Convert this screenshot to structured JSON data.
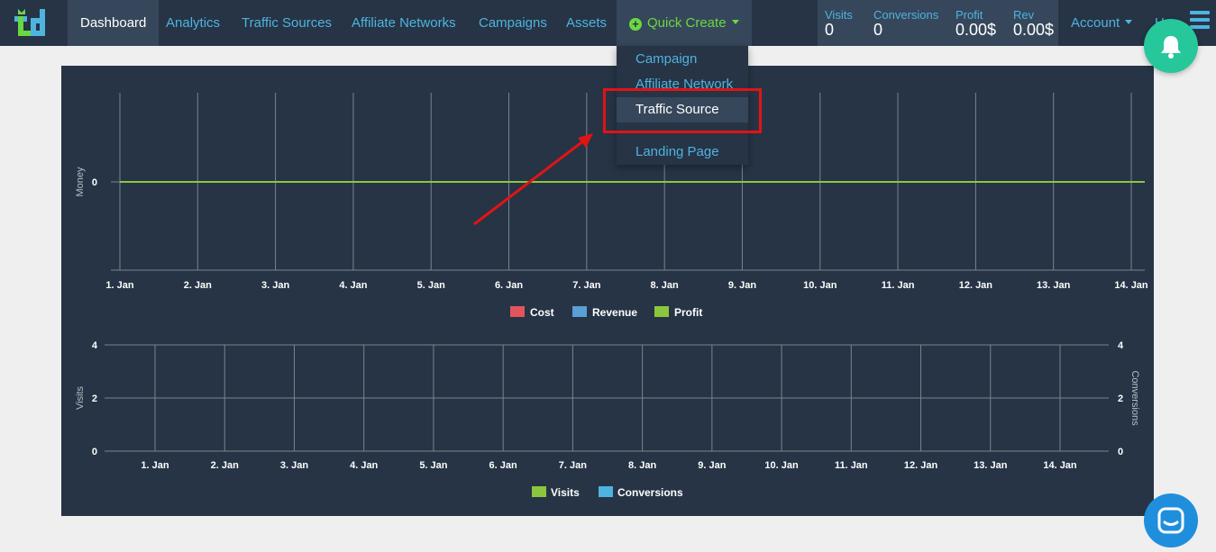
{
  "nav": {
    "items": [
      {
        "label": "Dashboard"
      },
      {
        "label": "Analytics"
      },
      {
        "label": "Traffic Sources"
      },
      {
        "label": "Affiliate Networks"
      },
      {
        "label": "Campaigns"
      },
      {
        "label": "Assets"
      }
    ],
    "quick_create": {
      "label": "Quick Create",
      "icon": "plus-circle-icon"
    },
    "account": {
      "label": "Account"
    },
    "help_partial": "H"
  },
  "stats": [
    {
      "label": "Visits",
      "value": "0"
    },
    {
      "label": "Conversions",
      "value": "0"
    },
    {
      "label": "Profit",
      "value": "0.00$"
    },
    {
      "label": "Rev",
      "value": "0.00$"
    }
  ],
  "dropdown": {
    "items": [
      {
        "label": "Campaign"
      },
      {
        "label": "Affiliate Network"
      },
      {
        "label": "Traffic Source",
        "selected": true
      },
      {
        "label": "Landing Page"
      }
    ]
  },
  "colors": {
    "topbar": "#263445",
    "active": "#36475b",
    "link": "#4fb3e0",
    "quick_create": "#6ad93f",
    "annotation": "#e11414",
    "bell": "#26c79b",
    "chat": "#1f8fdd"
  },
  "chart_data": [
    {
      "type": "line",
      "ylabel": "Money",
      "x": [
        "1. Jan",
        "2. Jan",
        "3. Jan",
        "4. Jan",
        "5. Jan",
        "6. Jan",
        "7. Jan",
        "8. Jan",
        "9. Jan",
        "10. Jan",
        "11. Jan",
        "12. Jan",
        "13. Jan",
        "14. Jan"
      ],
      "y_ticks": [
        "0"
      ],
      "series": [
        {
          "name": "Cost",
          "color": "#e3545d",
          "values": [
            0,
            0,
            0,
            0,
            0,
            0,
            0,
            0,
            0,
            0,
            0,
            0,
            0,
            0
          ]
        },
        {
          "name": "Revenue",
          "color": "#5a9fd6",
          "values": [
            0,
            0,
            0,
            0,
            0,
            0,
            0,
            0,
            0,
            0,
            0,
            0,
            0,
            0
          ]
        },
        {
          "name": "Profit",
          "color": "#8cc63f",
          "values": [
            0,
            0,
            0,
            0,
            0,
            0,
            0,
            0,
            0,
            0,
            0,
            0,
            0,
            0
          ]
        }
      ],
      "legend": "bottom-center",
      "grid": true
    },
    {
      "type": "line",
      "ylabel": "Visits",
      "y2label": "Conversions",
      "x": [
        "1. Jan",
        "2. Jan",
        "3. Jan",
        "4. Jan",
        "5. Jan",
        "6. Jan",
        "7. Jan",
        "8. Jan",
        "9. Jan",
        "10. Jan",
        "11. Jan",
        "12. Jan",
        "13. Jan",
        "14. Jan"
      ],
      "y_ticks": [
        "0",
        "2",
        "4"
      ],
      "y2_ticks": [
        "0",
        "2",
        "4"
      ],
      "ylim": [
        0,
        4
      ],
      "y2lim": [
        0,
        4
      ],
      "series": [
        {
          "name": "Visits",
          "color": "#8cc63f",
          "values": [
            0,
            0,
            0,
            0,
            0,
            0,
            0,
            0,
            0,
            0,
            0,
            0,
            0,
            0
          ]
        },
        {
          "name": "Conversions",
          "color": "#4fb3e0",
          "values": [
            0,
            0,
            0,
            0,
            0,
            0,
            0,
            0,
            0,
            0,
            0,
            0,
            0,
            0
          ]
        }
      ],
      "legend": "bottom-center",
      "grid": true
    }
  ]
}
